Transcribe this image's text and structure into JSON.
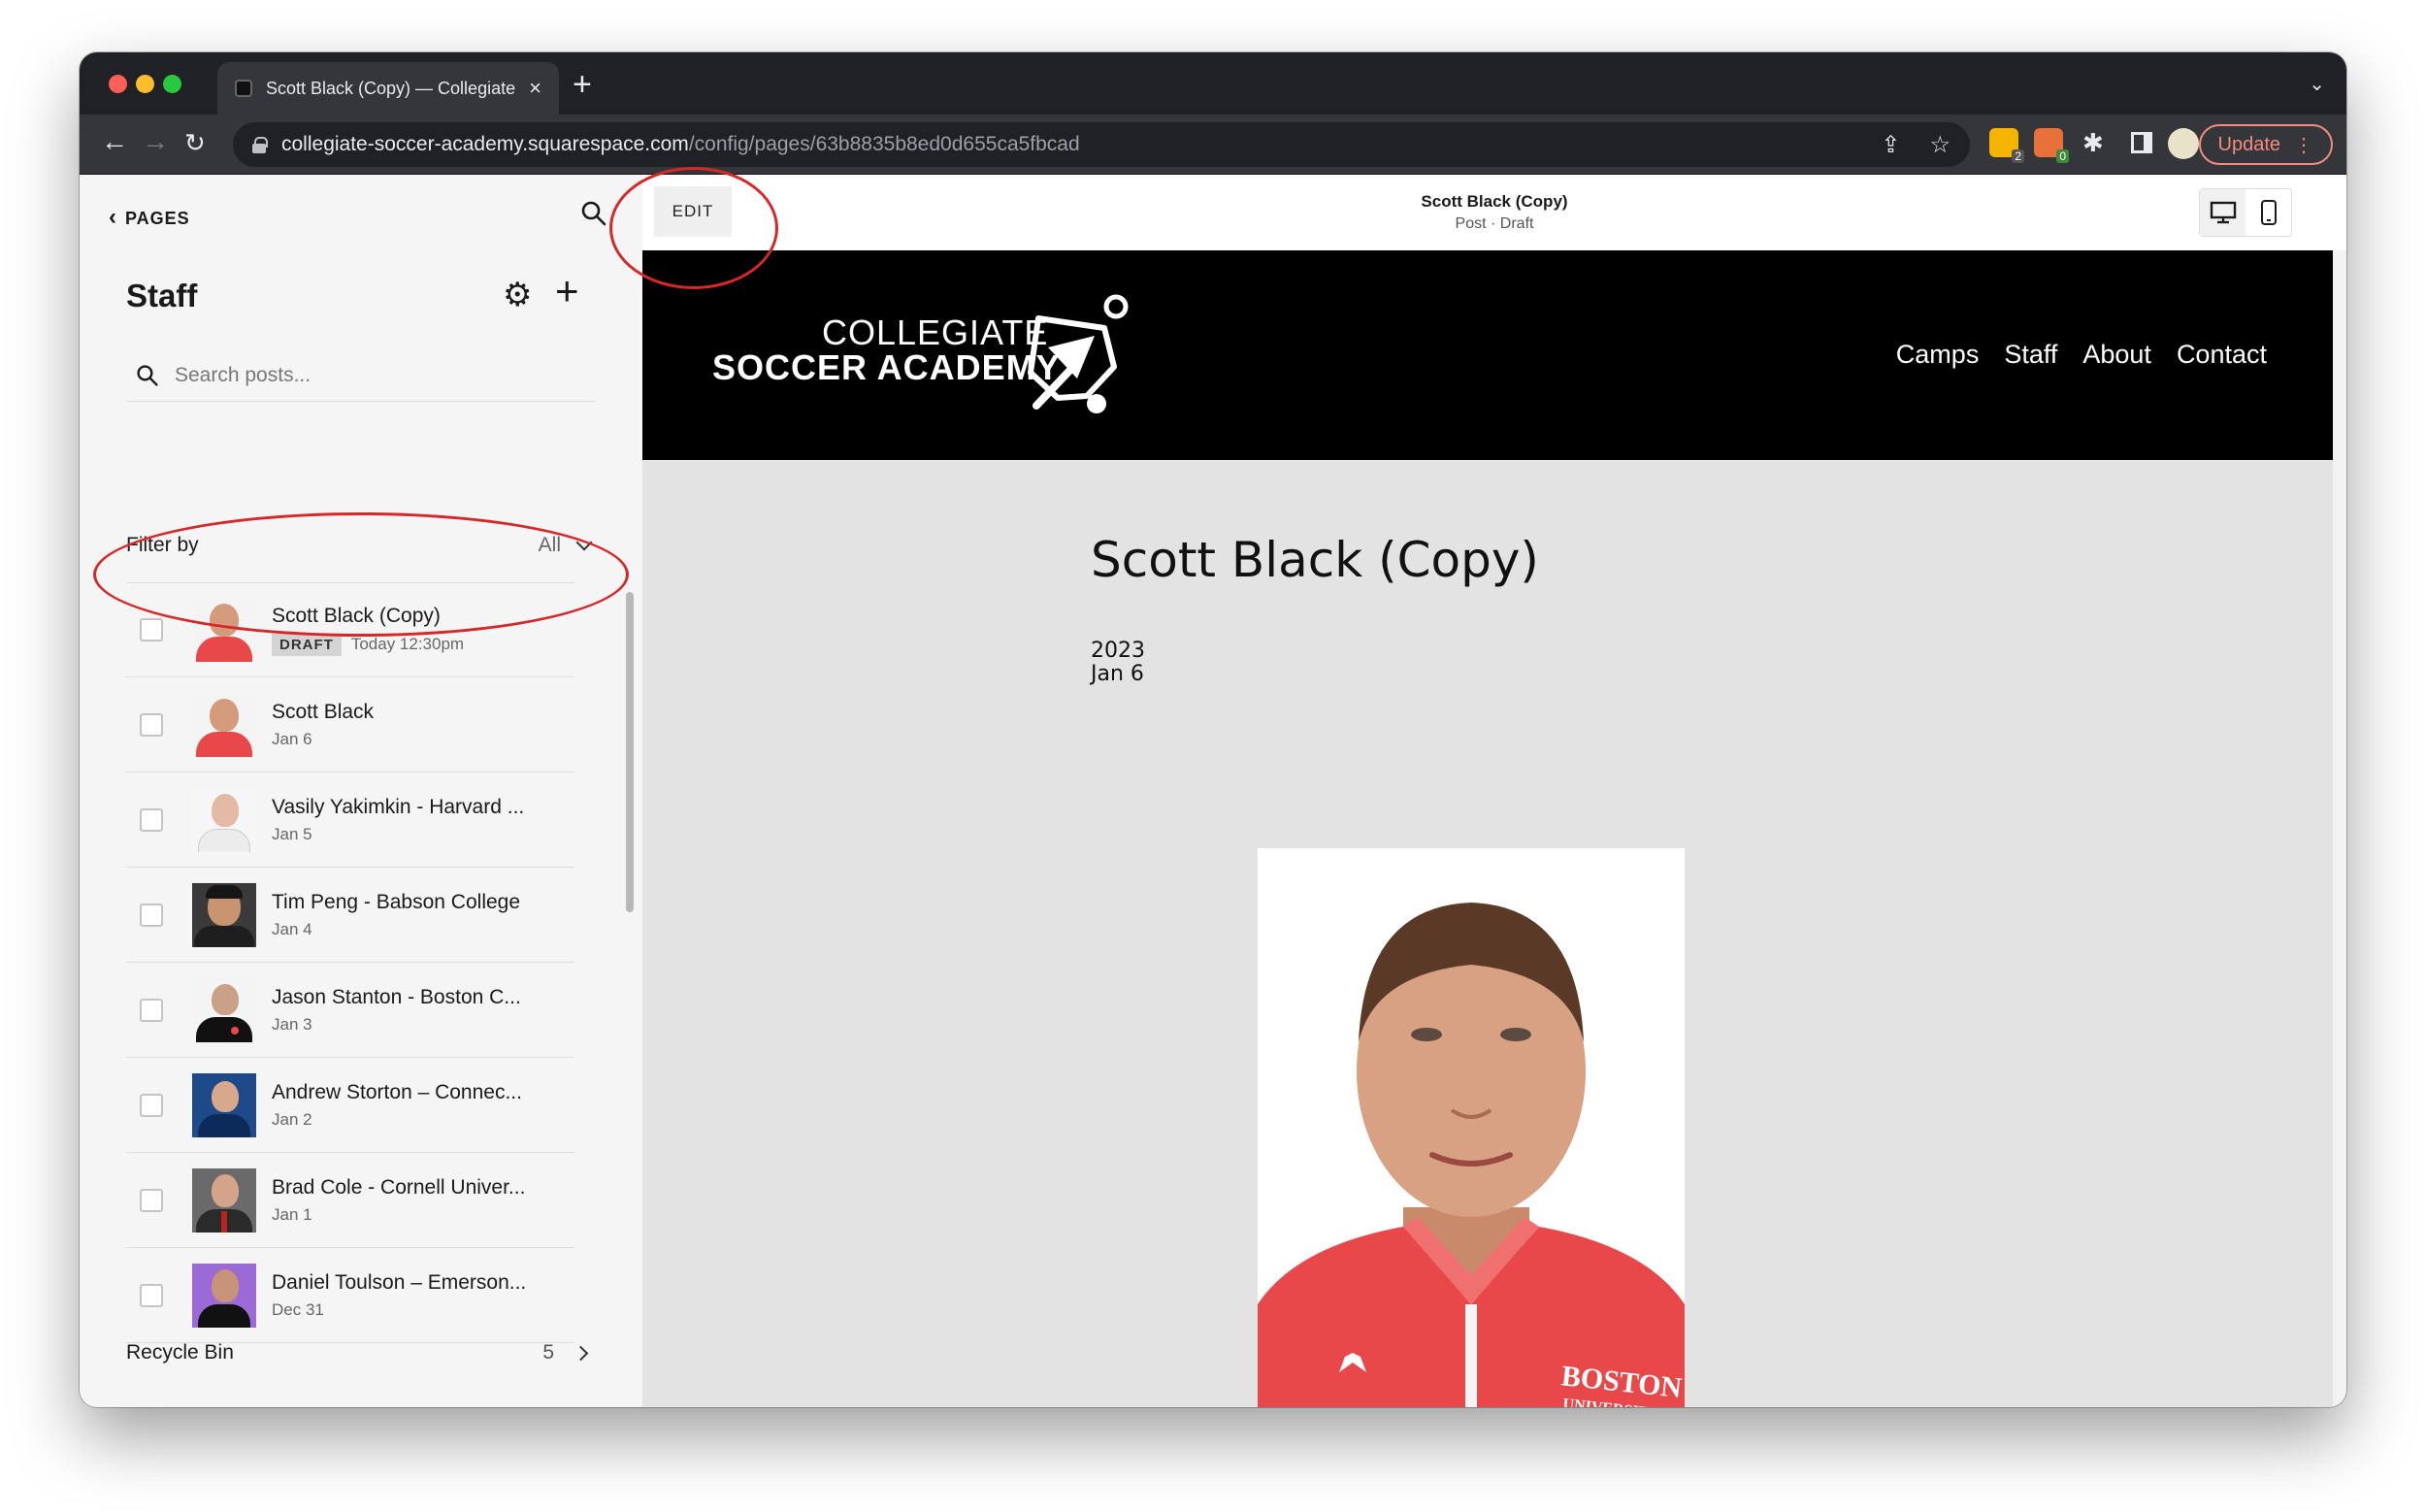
{
  "browser": {
    "tab_title": "Scott Black (Copy) — Collegiate",
    "url_host": "collegiate-soccer-academy.squarespace.com",
    "url_path": "/config/pages/63b8835b8ed0d655ca5fbcad",
    "update_label": "Update",
    "ext_badge_1": "2",
    "ext_badge_2": "0"
  },
  "sidebar": {
    "back_label": "PAGES",
    "title": "Staff",
    "search_placeholder": "Search posts...",
    "filter_label": "Filter by",
    "filter_value": "All",
    "recycle_label": "Recycle Bin",
    "recycle_count": "5",
    "posts": [
      {
        "title": "Scott Black (Copy)",
        "badge": "DRAFT",
        "meta": "Today 12:30pm"
      },
      {
        "title": "Scott Black",
        "meta": "Jan 6"
      },
      {
        "title": "Vasily Yakimkin - Harvard ...",
        "meta": "Jan 5"
      },
      {
        "title": "Tim Peng - Babson College",
        "meta": "Jan 4"
      },
      {
        "title": "Jason Stanton - Boston C...",
        "meta": "Jan 3"
      },
      {
        "title": "Andrew Storton – Connec...",
        "meta": "Jan 2"
      },
      {
        "title": "Brad Cole - Cornell Univer...",
        "meta": "Jan 1"
      },
      {
        "title": "Daniel Toulson – Emerson...",
        "meta": "Dec 31"
      }
    ]
  },
  "preview": {
    "edit_label": "EDIT",
    "title": "Scott Black (Copy)",
    "subtitle": "Post · Draft"
  },
  "site": {
    "logo_line1": "COLLEGIATE",
    "logo_line2": "SOCCER ACADEMY",
    "nav": [
      "Camps",
      "Staff",
      "About",
      "Contact"
    ],
    "post_title": "Scott Black (Copy)",
    "post_year": "2023",
    "post_date": "Jan 6",
    "jersey_text_1": "BOSTON",
    "jersey_text_2": "UNIVERSITY"
  },
  "colors": {
    "annotation": "#d62828",
    "site_header": "#000000",
    "jersey": "#e8484a"
  }
}
